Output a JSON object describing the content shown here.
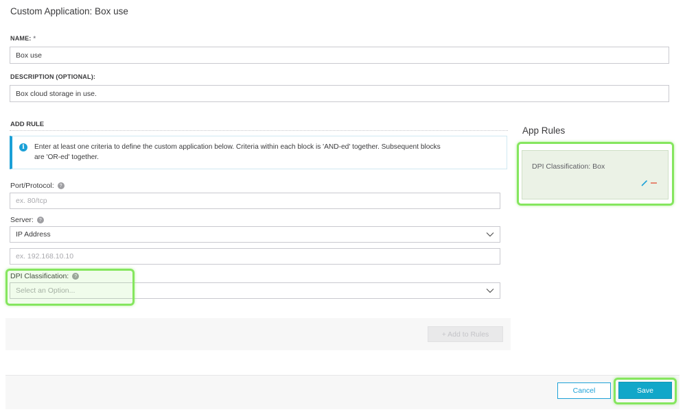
{
  "header": {
    "title": "Custom Application: Box use"
  },
  "name_field": {
    "label": "NAME:",
    "required_mark": "*",
    "value": "Box use"
  },
  "description_field": {
    "label": "DESCRIPTION (OPTIONAL):",
    "value": "Box cloud storage in use."
  },
  "add_rule": {
    "heading": "ADD RULE",
    "info_line1": "Enter at least one criteria to define the custom application below. Criteria within each block is 'AND-ed' together. Subsequent blocks",
    "info_line2": "are 'OR-ed' together.",
    "port_protocol": {
      "label": "Port/Protocol:",
      "placeholder": "ex. 80/tcp"
    },
    "server": {
      "label": "Server:",
      "selected": "IP Address",
      "ip_placeholder": "ex. 192.168.10.10"
    },
    "dpi_classification": {
      "label": "DPI Classification:",
      "placeholder": "Select an Option..."
    },
    "add_to_rules_label": "+ Add to Rules"
  },
  "app_rules": {
    "title": "App Rules",
    "rules": [
      {
        "text": "DPI Classification: Box"
      }
    ]
  },
  "footer": {
    "cancel_label": "Cancel",
    "save_label": "Save"
  },
  "colors": {
    "accent": "#1ba0d7",
    "save_button": "#12a7c9",
    "highlight": "#85e65e",
    "rule_card": "#ebf2e6",
    "edit_icon": "#1ba0d7",
    "delete_icon": "#e2583e"
  },
  "icons": [
    "info-icon",
    "help-icon",
    "chevron-down-icon",
    "edit-icon",
    "delete-icon"
  ]
}
